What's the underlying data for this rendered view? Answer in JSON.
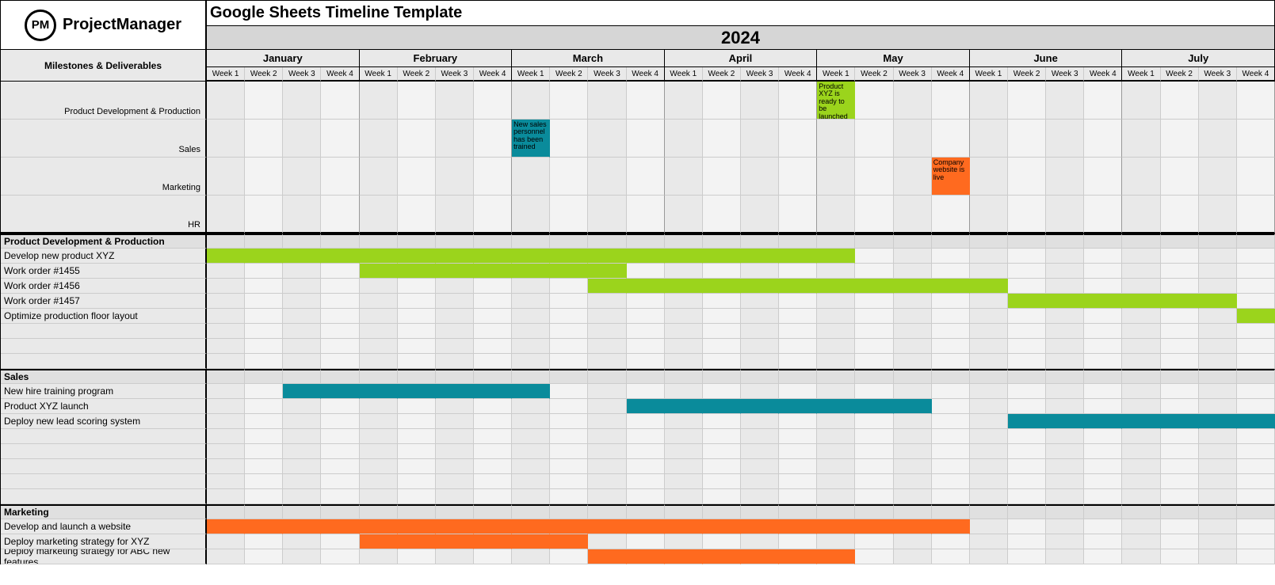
{
  "header": {
    "title": "Google Sheets Timeline Template",
    "brand_badge": "PM",
    "brand_name": "ProjectManager",
    "year": "2024",
    "side_header": "Milestones & Deliverables"
  },
  "months": [
    "January",
    "February",
    "March",
    "April",
    "May",
    "June",
    "July"
  ],
  "weeks": [
    "Week 1",
    "Week 2",
    "Week 3",
    "Week 4"
  ],
  "milestones": [
    {
      "label": "Product Development & Production",
      "week_index": 16,
      "color": "green",
      "text": "Product XYZ is ready to be launched"
    },
    {
      "label": "Sales",
      "week_index": 8,
      "color": "teal",
      "text": "New sales personnel has been trained"
    },
    {
      "label": "Marketing",
      "week_index": 19,
      "color": "orange",
      "text": "Company website is live"
    },
    {
      "label": "HR",
      "week_index": -1,
      "color": "",
      "text": ""
    }
  ],
  "sections": [
    {
      "name": "Product Development & Production",
      "color": "green",
      "tasks": [
        {
          "label": "Develop new product XYZ",
          "start": 0,
          "end": 17
        },
        {
          "label": "Work order #1455",
          "start": 4,
          "end": 11
        },
        {
          "label": "Work order #1456",
          "start": 10,
          "end": 21
        },
        {
          "label": "Work order #1457",
          "start": 21,
          "end": 27
        },
        {
          "label": "Optimize production floor layout",
          "start": 27,
          "end": 28
        },
        {
          "label": "",
          "start": -1,
          "end": -1
        },
        {
          "label": "",
          "start": -1,
          "end": -1
        },
        {
          "label": "",
          "start": -1,
          "end": -1
        }
      ]
    },
    {
      "name": "Sales",
      "color": "teal",
      "tasks": [
        {
          "label": "New hire training program",
          "start": 2,
          "end": 9
        },
        {
          "label": "Product XYZ launch",
          "start": 11,
          "end": 19
        },
        {
          "label": "Deploy new lead scoring system",
          "start": 21,
          "end": 28
        },
        {
          "label": "",
          "start": -1,
          "end": -1
        },
        {
          "label": "",
          "start": -1,
          "end": -1
        },
        {
          "label": "",
          "start": -1,
          "end": -1
        },
        {
          "label": "",
          "start": -1,
          "end": -1
        },
        {
          "label": "",
          "start": -1,
          "end": -1
        }
      ]
    },
    {
      "name": "Marketing",
      "color": "orange",
      "tasks": [
        {
          "label": "Develop and launch a website",
          "start": 0,
          "end": 20
        },
        {
          "label": "Deploy marketing strategy for XYZ",
          "start": 4,
          "end": 10
        },
        {
          "label": "Deploy marketing strategy for ABC new features",
          "start": 10,
          "end": 17
        }
      ]
    }
  ],
  "chart_data": {
    "type": "gantt",
    "x_unit": "week",
    "x_range": [
      1,
      28
    ],
    "months": [
      "January",
      "February",
      "March",
      "April",
      "May",
      "June",
      "July"
    ],
    "weeks_per_month": 4,
    "year": 2024,
    "milestones": [
      {
        "category": "Product Development & Production",
        "week": 17,
        "label": "Product XYZ is ready to be launched"
      },
      {
        "category": "Sales",
        "week": 9,
        "label": "New sales personnel has been trained"
      },
      {
        "category": "Marketing",
        "week": 20,
        "label": "Company website is live"
      }
    ],
    "series": [
      {
        "group": "Product Development & Production",
        "name": "Develop new product XYZ",
        "start_week": 1,
        "end_week": 18,
        "color": "#9bd41c"
      },
      {
        "group": "Product Development & Production",
        "name": "Work order #1455",
        "start_week": 5,
        "end_week": 12,
        "color": "#9bd41c"
      },
      {
        "group": "Product Development & Production",
        "name": "Work order #1456",
        "start_week": 11,
        "end_week": 22,
        "color": "#9bd41c"
      },
      {
        "group": "Product Development & Production",
        "name": "Work order #1457",
        "start_week": 22,
        "end_week": 28,
        "color": "#9bd41c"
      },
      {
        "group": "Product Development & Production",
        "name": "Optimize production floor layout",
        "start_week": 28,
        "end_week": 28,
        "color": "#9bd41c"
      },
      {
        "group": "Sales",
        "name": "New hire training program",
        "start_week": 3,
        "end_week": 10,
        "color": "#0a8b9b"
      },
      {
        "group": "Sales",
        "name": "Product XYZ launch",
        "start_week": 12,
        "end_week": 20,
        "color": "#0a8b9b"
      },
      {
        "group": "Sales",
        "name": "Deploy new lead scoring system",
        "start_week": 22,
        "end_week": 28,
        "color": "#0a8b9b"
      },
      {
        "group": "Marketing",
        "name": "Develop and launch a website",
        "start_week": 1,
        "end_week": 21,
        "color": "#ff6a1f"
      },
      {
        "group": "Marketing",
        "name": "Deploy marketing strategy for XYZ",
        "start_week": 5,
        "end_week": 11,
        "color": "#ff6a1f"
      },
      {
        "group": "Marketing",
        "name": "Deploy marketing strategy for ABC new features",
        "start_week": 11,
        "end_week": 18,
        "color": "#ff6a1f"
      }
    ]
  }
}
